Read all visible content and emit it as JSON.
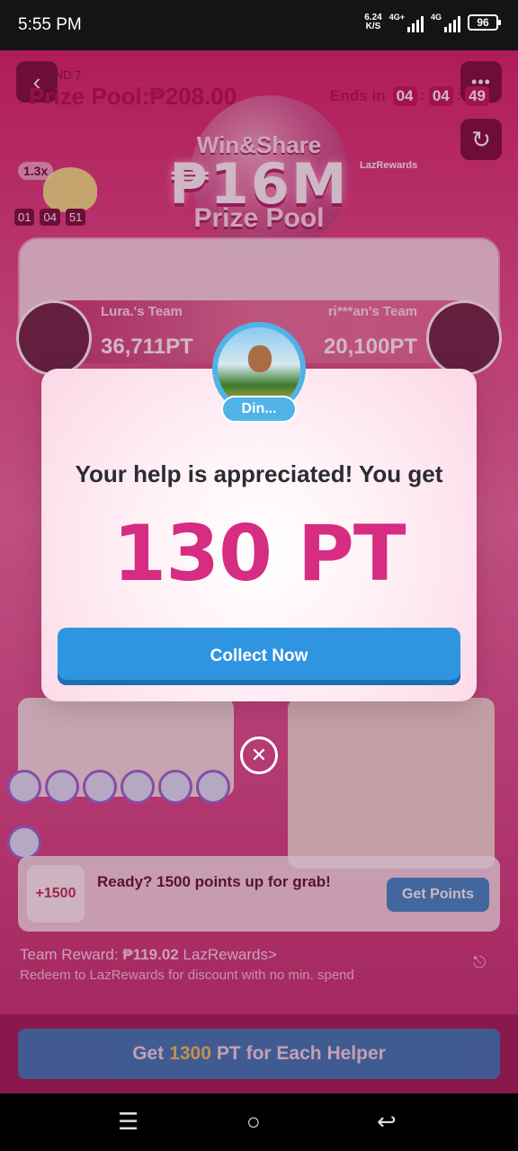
{
  "status_bar": {
    "time": "5:55 PM",
    "net_speed_value": "6.24",
    "net_speed_unit": "K/S",
    "sim1_label": "4G+",
    "sim2_label": "4G",
    "battery": "96"
  },
  "header": {
    "back_icon": "chevron-left-icon",
    "more_icon": "more-dots-icon",
    "refresh_icon": "refresh-icon",
    "hero_line1": "Win&Share",
    "hero_amount": "₱16M",
    "hero_line3": "Prize Pool",
    "brand_badge": "LazRewards",
    "multiplier": "1.3x",
    "timer": [
      "01",
      "04",
      "51"
    ]
  },
  "round": {
    "label": "ROUND 7",
    "prize_pool_label": "Prize Pool:₱208.00",
    "ends_in_label": "Ends in",
    "ends_in": [
      "04",
      "04",
      "49"
    ],
    "left_team_name": "Lura.'s Team",
    "left_team_score": "36,711PT",
    "right_team_name": "ri***an's Team",
    "right_team_score": "20,100PT"
  },
  "dialog": {
    "helper_name": "Din...",
    "message": "Your help is appreciated! You get",
    "points": "130 PT",
    "collect_label": "Collect Now",
    "close_icon": "close-circle-icon"
  },
  "points_card": {
    "badge": "+1500",
    "text": "Ready? 1500 points up for grab!",
    "button_label": "Get Points"
  },
  "team_reward": {
    "label": "Team Reward:",
    "amount": "₱119.02",
    "link": "LazRewards>",
    "note": "Redeem to LazRewards for discount with no min. spend",
    "exit_icon": "exit-icon"
  },
  "cta": {
    "prefix": "Get",
    "number": "1300",
    "suffix": "PT for Each Helper"
  },
  "nav": {
    "menu_icon": "menu-icon",
    "home_icon": "home-icon",
    "back_icon": "back-icon"
  }
}
